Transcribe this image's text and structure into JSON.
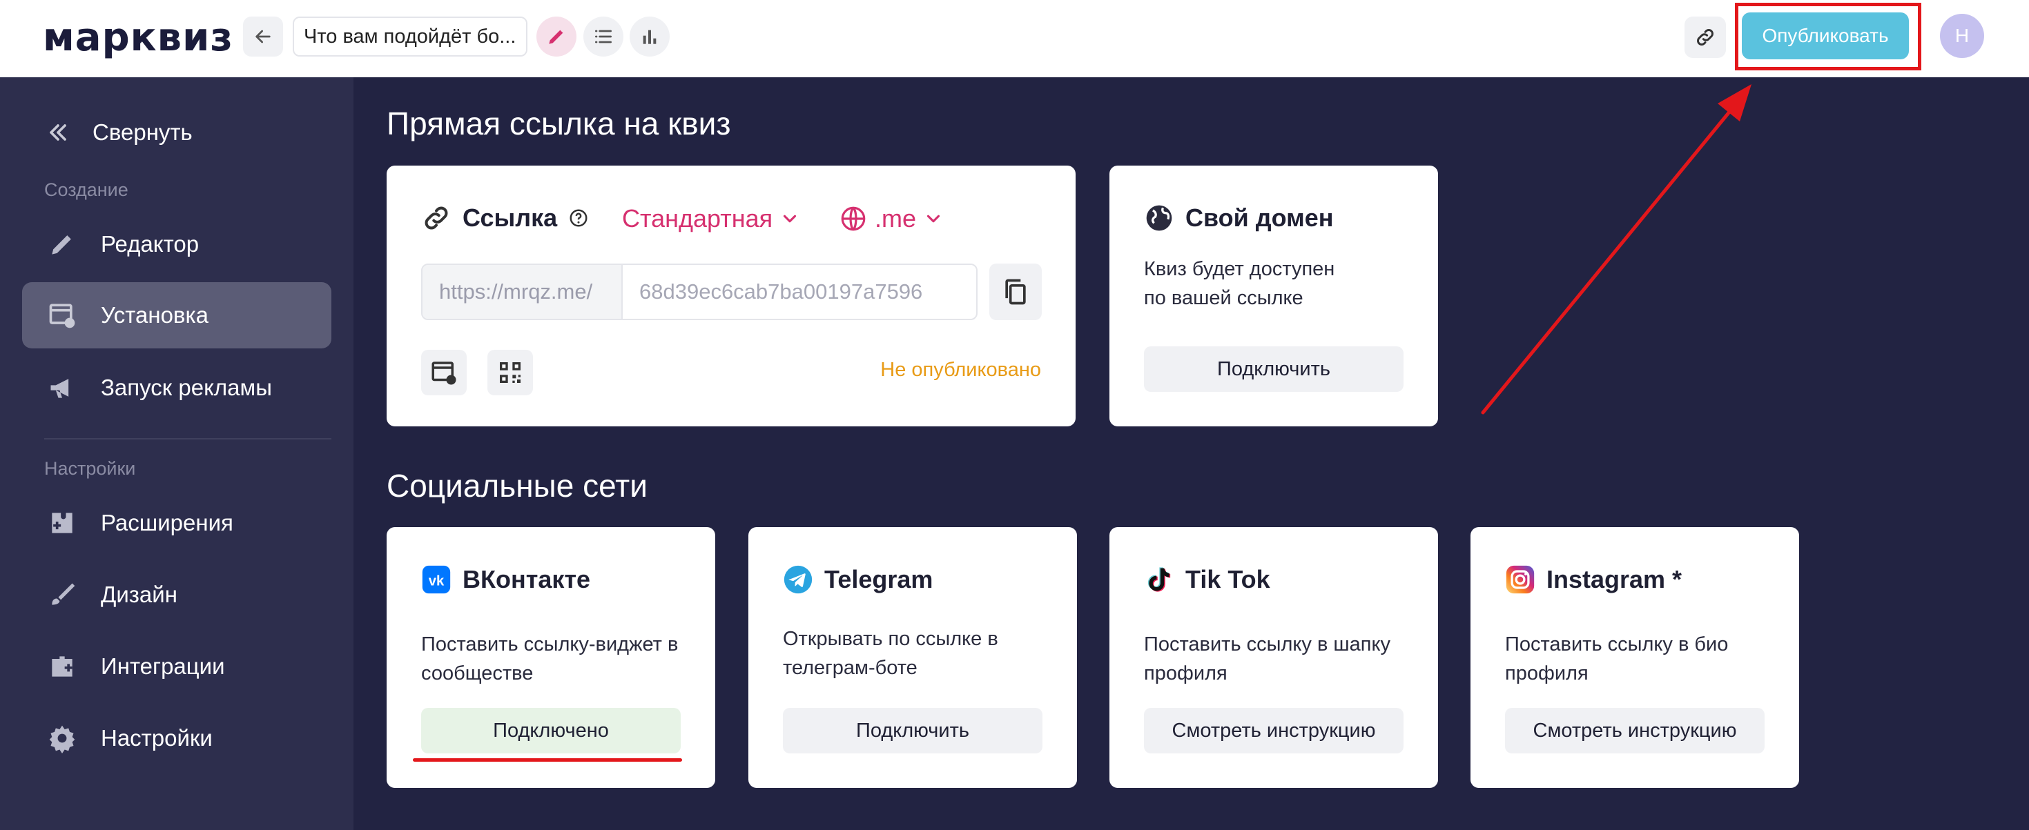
{
  "header": {
    "logo": "марквиз",
    "quiz_title": "Что вам подойдёт бо...",
    "publish_label": "Опубликовать",
    "avatar_initial": "Н",
    "icons": [
      "back-arrow-icon",
      "pencil-icon",
      "list-icon",
      "bar-chart-icon",
      "link-icon"
    ]
  },
  "sidebar": {
    "collapse_label": "Свернуть",
    "section_create": "Создание",
    "section_settings": "Настройки",
    "items": [
      {
        "label": "Редактор",
        "icon": "pencil-icon"
      },
      {
        "label": "Установка",
        "icon": "install-window-icon",
        "active": true
      },
      {
        "label": "Запуск рекламы",
        "icon": "megaphone-icon"
      },
      {
        "label": "Расширения",
        "icon": "extension-icon"
      },
      {
        "label": "Дизайн",
        "icon": "brush-icon"
      },
      {
        "label": "Интеграции",
        "icon": "integrations-icon"
      },
      {
        "label": "Настройки",
        "icon": "gear-icon"
      }
    ]
  },
  "direct_link": {
    "section_title": "Прямая ссылка на квиз",
    "link_label": "Ссылка",
    "link_type": "Стандартная",
    "domain_zone": ".me",
    "url_prefix": "https://mrqz.me/",
    "url_value": "68d39ec6cab7ba00197a7596",
    "status": "Не опубликовано"
  },
  "custom_domain": {
    "title": "Свой домен",
    "desc_line1": "Квиз будет доступен",
    "desc_line2": "по вашей ссылке",
    "button": "Подключить"
  },
  "social": {
    "section_title": "Социальные сети",
    "cards": [
      {
        "title": "ВКонтакте",
        "desc_line1": "Поставить ссылку-виджет в",
        "desc_line2": "сообществе",
        "button": "Подключено",
        "icon": "vk-icon"
      },
      {
        "title": "Telegram",
        "desc_line1": "Открывать по ссылке в",
        "desc_line2": "телеграм-боте",
        "button": "Подключить",
        "icon": "telegram-icon"
      },
      {
        "title": "Tik Tok",
        "desc_line1": "Поставить ссылку в шапку",
        "desc_line2": "профиля",
        "button": "Смотреть инструкцию",
        "icon": "tiktok-icon"
      },
      {
        "title": "Instagram *",
        "desc_line1": "Поставить ссылку в био",
        "desc_line2": "профиля",
        "button": "Смотреть инструкцию",
        "icon": "instagram-icon"
      }
    ]
  },
  "colors": {
    "dark_bg": "#222342",
    "sidebar_bg": "#2d2e4d",
    "accent_pink": "#d6306f",
    "publish_blue": "#5ac2de",
    "annotation_red": "#e3171b",
    "status_orange": "#e89b16"
  }
}
